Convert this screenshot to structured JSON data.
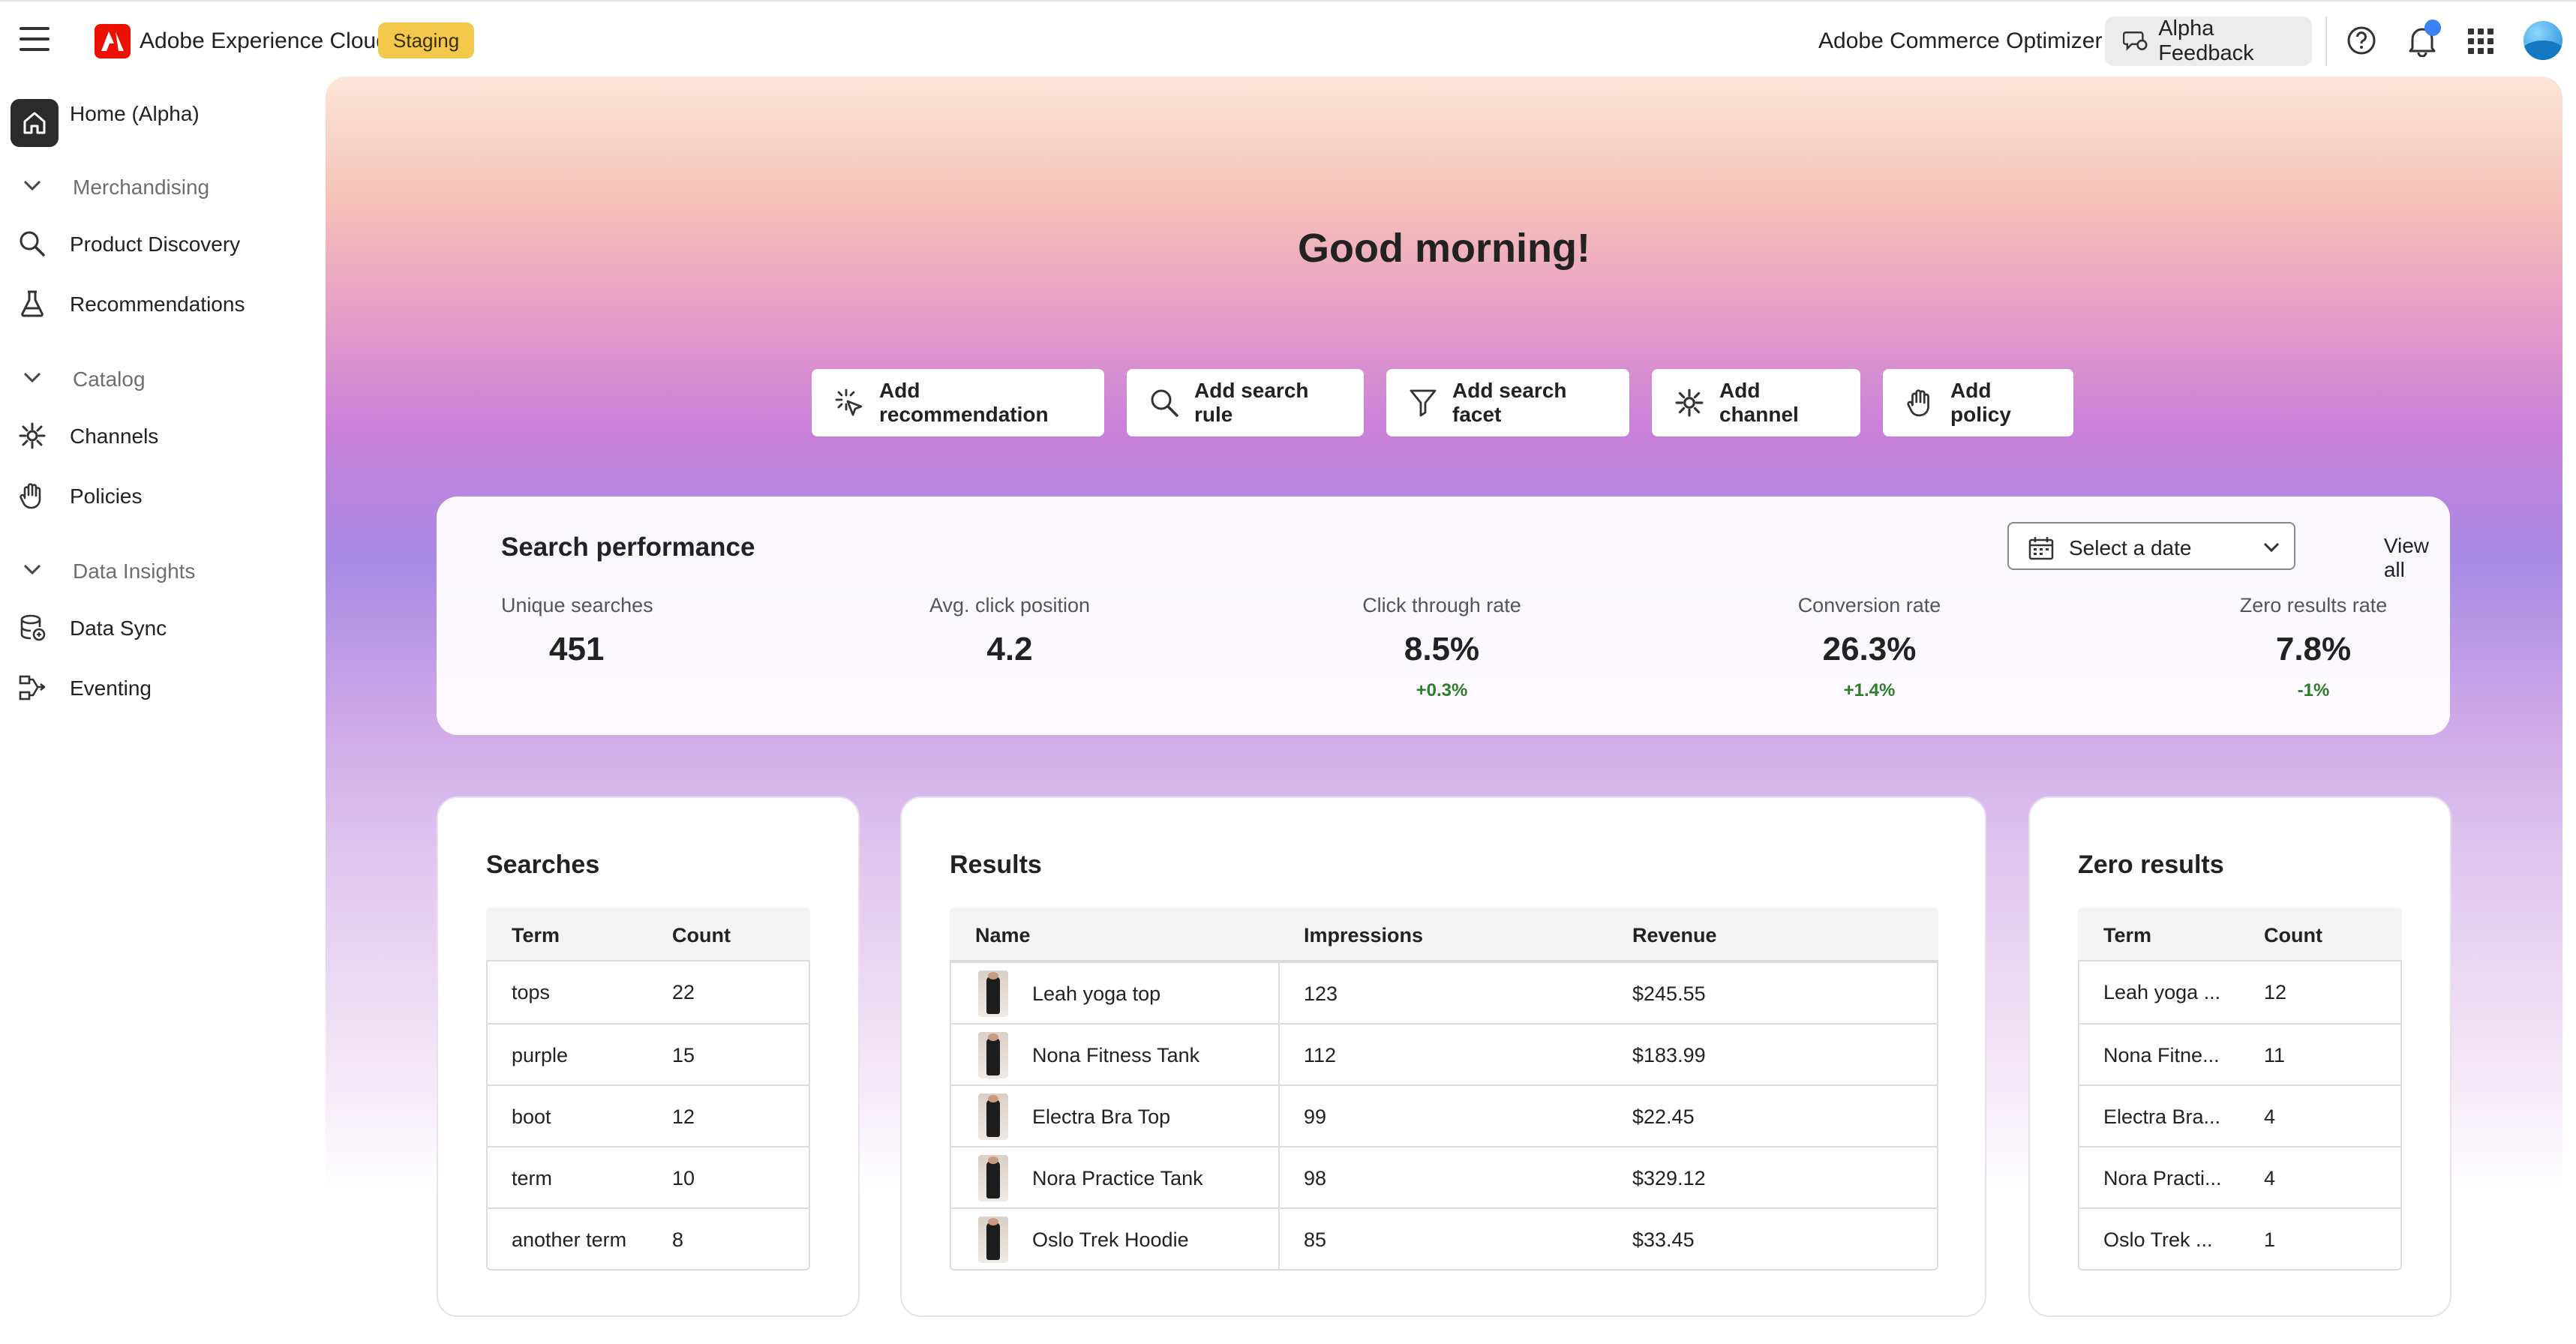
{
  "header": {
    "brand": "Adobe Experience Cloud",
    "environment_badge": "Staging",
    "product": "Adobe Commerce Optimizer",
    "feedback_label": "Alpha Feedback"
  },
  "sidebar": {
    "home_label": "Home (Alpha)",
    "sections": [
      {
        "label": "Merchandising",
        "items": [
          {
            "label": "Product Discovery",
            "icon": "search-icon"
          },
          {
            "label": "Recommendations",
            "icon": "flask-icon"
          }
        ]
      },
      {
        "label": "Catalog",
        "items": [
          {
            "label": "Channels",
            "icon": "channels-icon"
          },
          {
            "label": "Policies",
            "icon": "hand-icon"
          }
        ]
      },
      {
        "label": "Data Insights",
        "items": [
          {
            "label": "Data Sync",
            "icon": "database-icon"
          },
          {
            "label": "Eventing",
            "icon": "eventing-icon"
          }
        ]
      }
    ]
  },
  "main": {
    "greeting": "Good morning!",
    "quick_actions": [
      {
        "label": "Add recommendation",
        "icon": "sparkle-cursor-icon"
      },
      {
        "label": "Add search rule",
        "icon": "search-icon"
      },
      {
        "label": "Add search facet",
        "icon": "filter-icon"
      },
      {
        "label": "Add channel",
        "icon": "channels-icon"
      },
      {
        "label": "Add policy",
        "icon": "hand-icon"
      }
    ]
  },
  "performance": {
    "title": "Search performance",
    "date_placeholder": "Select a date",
    "view_all": "View all",
    "metrics": [
      {
        "label": "Unique searches",
        "value": "451",
        "delta": ""
      },
      {
        "label": "Avg. click position",
        "value": "4.2",
        "delta": ""
      },
      {
        "label": "Click through rate",
        "value": "8.5%",
        "delta": "+0.3%"
      },
      {
        "label": "Conversion rate",
        "value": "26.3%",
        "delta": "+1.4%"
      },
      {
        "label": "Zero results rate",
        "value": "7.8%",
        "delta": "-1%"
      }
    ],
    "positive_color": "#2d7d2d"
  },
  "searches": {
    "title": "Searches",
    "columns": [
      "Term",
      "Count"
    ],
    "rows": [
      [
        "tops",
        "22"
      ],
      [
        "purple",
        "15"
      ],
      [
        "boot",
        "12"
      ],
      [
        "term",
        "10"
      ],
      [
        "another term",
        "8"
      ]
    ]
  },
  "results": {
    "title": "Results",
    "columns": [
      "Name",
      "Impressions",
      "Revenue"
    ],
    "rows": [
      [
        "Leah yoga top",
        "123",
        "$245.55"
      ],
      [
        "Nona Fitness Tank",
        "112",
        "$183.99"
      ],
      [
        "Electra Bra Top",
        "99",
        "$22.45"
      ],
      [
        "Nora Practice Tank",
        "98",
        "$329.12"
      ],
      [
        "Oslo Trek Hoodie",
        "85",
        "$33.45"
      ]
    ]
  },
  "zero_results": {
    "title": "Zero results",
    "columns": [
      "Term",
      "Count"
    ],
    "rows": [
      [
        "Leah yoga ...",
        "12"
      ],
      [
        "Nona Fitne...",
        "11"
      ],
      [
        "Electra Bra...",
        "4"
      ],
      [
        "Nora Practi...",
        "4"
      ],
      [
        "Oslo Trek ...",
        "1"
      ]
    ]
  }
}
